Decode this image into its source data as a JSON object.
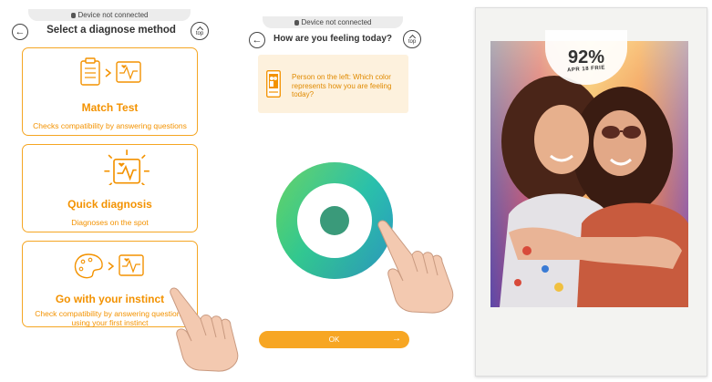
{
  "status": {
    "text": "Device not connected"
  },
  "panel1": {
    "title": "Select a diagnose method",
    "top_label": "top",
    "cards": [
      {
        "title": "Match Test",
        "desc": "Checks compatibility by answering questions"
      },
      {
        "title": "Quick diagnosis",
        "desc": "Diagnoses on the spot"
      },
      {
        "title": "Go with your instinct",
        "desc": "Check compatibility by answering questions using your first instinct"
      }
    ]
  },
  "panel2": {
    "title": "How are you feeling today?",
    "top_label": "top",
    "question": "Person on the left: Which color represents how you are feeling today?",
    "ok_label": "OK",
    "ok_arrow": "→"
  },
  "photo": {
    "percent": "92%",
    "caption": "APR 18 FRIE"
  },
  "colors": {
    "accent": "#f39200",
    "ok_button": "#f7a623",
    "question_bg": "#fdf1dd",
    "wheel_center": "#3a9a7a"
  }
}
